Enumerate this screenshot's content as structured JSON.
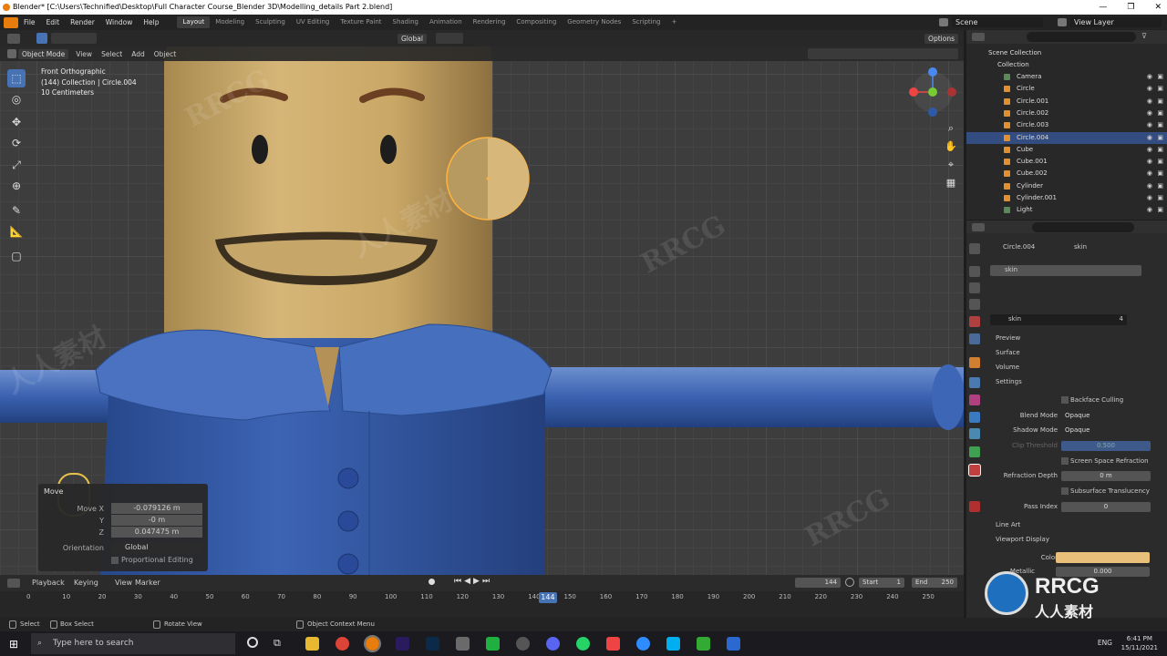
{
  "titlebar": {
    "title": "Blender* [C:\\Users\\Technified\\Desktop\\Full Character Course_Blender 3D\\Modelling_details Part 2.blend]",
    "min": "—",
    "max": "❐",
    "close": "✕"
  },
  "menu": {
    "items": [
      "File",
      "Edit",
      "Render",
      "Window",
      "Help"
    ]
  },
  "workspaces": [
    "Layout",
    "Modeling",
    "Sculpting",
    "UV Editing",
    "Texture Paint",
    "Shading",
    "Animation",
    "Rendering",
    "Compositing",
    "Geometry Nodes",
    "Scripting",
    "+"
  ],
  "scene": {
    "label": "Scene",
    "view_layer": "View Layer"
  },
  "header": {
    "orientation": "Global",
    "options": "Options",
    "mode": "Object Mode",
    "view": "View",
    "select": "Select",
    "add": "Add",
    "object": "Object"
  },
  "overlay_text": {
    "view_name": "Front Orthographic",
    "collection": "(144) Collection | Circle.004",
    "scale": "10 Centimeters"
  },
  "operator_panel": {
    "title": "Move",
    "move_x_label": "Move X",
    "move_x": "-0.079126 m",
    "y_label": "Y",
    "y": "-0 m",
    "z_label": "Z",
    "z": "0.047475 m",
    "orientation_label": "Orientation",
    "orientation": "Global",
    "proportional": "Proportional Editing"
  },
  "outliner": {
    "root": "Scene Collection",
    "collection": "Collection",
    "items": [
      "Camera",
      "Circle",
      "Circle.001",
      "Circle.002",
      "Circle.003",
      "Circle.004",
      "Cube",
      "Cube.001",
      "Cube.002",
      "Cylinder",
      "Cylinder.001",
      "Light"
    ],
    "selected_index": 5
  },
  "properties": {
    "object": "Circle.004",
    "material_tab": "skin",
    "slot": "skin",
    "material_name": "skin",
    "users": "4",
    "sections": {
      "preview": "Preview",
      "surface": "Surface",
      "volume": "Volume",
      "settings": "Settings",
      "line_art": "Line Art",
      "viewport_display": "Viewport Display"
    },
    "backface": "Backface Culling",
    "blend_mode_label": "Blend Mode",
    "blend_mode": "Opaque",
    "shadow_mode_label": "Shadow Mode",
    "shadow_mode": "Opaque",
    "clip_label": "Clip Threshold",
    "clip": "0.500",
    "ssr": "Screen Space Refraction",
    "refr_depth_label": "Refraction Depth",
    "refr_depth": "0 m",
    "subsurface": "Subsurface Translucency",
    "pass_index_label": "Pass Index",
    "pass_index": "0",
    "color_label": "Color",
    "metallic_label": "Metallic",
    "metallic": "0.000",
    "color_hex": "#e8c07a"
  },
  "timeline": {
    "playback": "Playback",
    "keying": "Keying",
    "view": "View",
    "marker": "Marker",
    "current_frame": "144",
    "start_label": "Start",
    "start": "1",
    "end_label": "End",
    "end": "250",
    "ticks": [
      "0",
      "10",
      "20",
      "30",
      "40",
      "50",
      "60",
      "70",
      "80",
      "90",
      "100",
      "110",
      "120",
      "130",
      "140",
      "150",
      "160",
      "170",
      "180",
      "190",
      "200",
      "210",
      "220",
      "230",
      "240",
      "250"
    ]
  },
  "status": {
    "select": "Select",
    "box_select": "Box Select",
    "rotate": "Rotate View",
    "context": "Object Context Menu"
  },
  "taskbar": {
    "search": "Type here to search",
    "lang": "ENG",
    "time": "6:41 PM",
    "date": "15/11/2021"
  },
  "watermarks": {
    "rrcg": "RRCG",
    "cn": "人人素材"
  }
}
